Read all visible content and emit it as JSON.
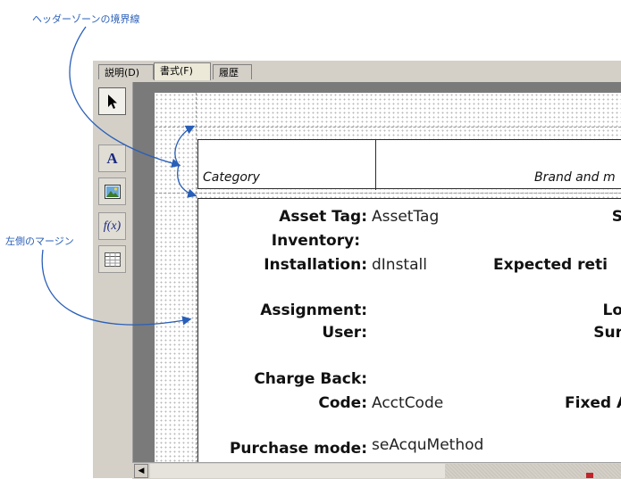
{
  "annotations": {
    "header_boundary": "ヘッダーゾーンの境界線",
    "left_margin": "左側のマージン"
  },
  "tabs": [
    {
      "label": "説明(D)",
      "active": false
    },
    {
      "label": "書式(F)",
      "active": true
    },
    {
      "label": "履歴",
      "active": false
    }
  ],
  "toolbox": [
    {
      "icon": "arrow-pointer-icon",
      "selected": true
    },
    {
      "icon": "text-icon",
      "glyph": "A"
    },
    {
      "icon": "image-icon"
    },
    {
      "icon": "formula-icon",
      "glyph": "f(x)"
    },
    {
      "icon": "table-icon"
    }
  ],
  "header_band": {
    "column_1": "Category",
    "column_2": "Brand and m"
  },
  "body_band": {
    "asset_tag_label": "Asset Tag:",
    "asset_tag_value": "AssetTag",
    "inventory_label": "Inventory:",
    "installation_label": "Installation:",
    "installation_value": "dInstall",
    "expected_label": "Expected reti",
    "s_label": "S",
    "assignment_label": "Assignment:",
    "user_label": "User:",
    "lo_label": "Lo",
    "sur_label": "Sur",
    "charge_back_label": "Charge Back:",
    "code_label": "Code:",
    "code_value": "AcctCode",
    "fixed_label": "Fixed A",
    "purchase_mode_label": "Purchase mode:",
    "purchase_mode_value": "seAcquMethod"
  },
  "colors": {
    "annotation": "#2a5fb8",
    "chrome": "#d4d0c8",
    "frame": "#7a7a7a"
  }
}
